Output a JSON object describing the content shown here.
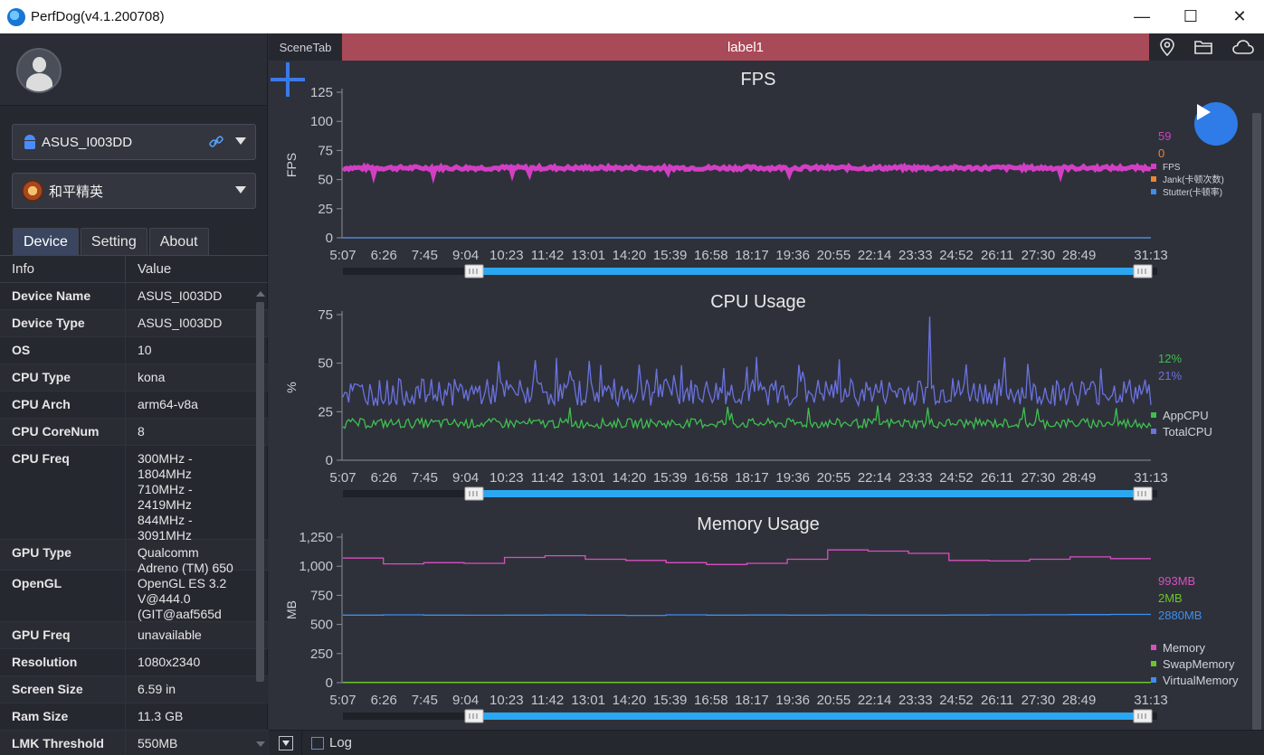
{
  "window": {
    "title": "PerfDog(v4.1.200708)",
    "controls": [
      "—",
      "☐",
      "✕"
    ]
  },
  "sidebar": {
    "device_select": "ASUS_I003DD",
    "app_select": "和平精英",
    "tabs": [
      {
        "label": "Device",
        "active": true
      },
      {
        "label": "Setting",
        "active": false
      },
      {
        "label": "About",
        "active": false
      }
    ],
    "info_header": {
      "key": "Info",
      "value": "Value"
    },
    "info_rows": [
      {
        "key": "Device Name",
        "value": "ASUS_I003DD"
      },
      {
        "key": "Device Type",
        "value": "ASUS_I003DD"
      },
      {
        "key": "OS",
        "value": "10"
      },
      {
        "key": "CPU Type",
        "value": "kona"
      },
      {
        "key": "CPU Arch",
        "value": "arm64-v8a"
      },
      {
        "key": "CPU CoreNum",
        "value": "8"
      },
      {
        "key": "CPU Freq",
        "value": "300MHz -\n1804MHz\n710MHz -\n2419MHz\n844MHz -\n3091MHz"
      },
      {
        "key": "GPU Type",
        "value": "Qualcomm\nAdreno (TM) 650"
      },
      {
        "key": "OpenGL",
        "value": "OpenGL ES 3.2\nV@444.0\n(GIT@aaf565d"
      },
      {
        "key": "GPU Freq",
        "value": "unavailable"
      },
      {
        "key": "Resolution",
        "value": "1080x2340"
      },
      {
        "key": "Screen Size",
        "value": "6.59 in"
      },
      {
        "key": "Ram Size",
        "value": "11.3 GB"
      },
      {
        "key": "LMK Threshold",
        "value": "550MB"
      }
    ]
  },
  "main": {
    "scene_tab": "SceneTab",
    "label": "label1",
    "top_icons": [
      "location-icon",
      "folder-icon",
      "cloud-icon"
    ],
    "log_label": "Log"
  },
  "colors": {
    "fps": "#d23fc4",
    "jank": "#f0832f",
    "stutter": "#3d8ef0",
    "appcpu": "#3fbf4f",
    "totalcpu": "#6b72e0",
    "memory": "#d94fc0",
    "swap": "#6cc627",
    "virtual": "#3d8ef0",
    "slider": "#2aa7f0",
    "axis": "#8a8e98"
  },
  "chart_data": [
    {
      "type": "line",
      "title": "FPS",
      "ylabel": "FPS",
      "ylim": [
        0,
        125
      ],
      "yticks": [
        "0",
        "25",
        "50",
        "75",
        "100",
        "125"
      ],
      "x_ticks": [
        "5:07",
        "6:26",
        "7:45",
        "9:04",
        "10:23",
        "11:42",
        "13:01",
        "14:20",
        "15:39",
        "16:58",
        "18:17",
        "19:36",
        "20:55",
        "22:14",
        "23:33",
        "24:52",
        "26:11",
        "27:30",
        "28:49",
        "31:13"
      ],
      "current_values": [
        "59",
        "0"
      ],
      "series": [
        {
          "name": "FPS",
          "baseline": 60
        },
        {
          "name": "Jank(卡顿次数)",
          "baseline": 0
        },
        {
          "name": "Stutter(卡顿率)",
          "baseline": 0
        }
      ]
    },
    {
      "type": "line",
      "title": "CPU Usage",
      "ylabel": "%",
      "ylim": [
        0,
        75
      ],
      "yticks": [
        "0",
        "25",
        "50",
        "75"
      ],
      "x_ticks": [
        "5:07",
        "6:26",
        "7:45",
        "9:04",
        "10:23",
        "11:42",
        "13:01",
        "14:20",
        "15:39",
        "16:58",
        "18:17",
        "19:36",
        "20:55",
        "22:14",
        "23:33",
        "24:52",
        "26:11",
        "27:30",
        "28:49",
        "31:13"
      ],
      "current_values": [
        "12%",
        "21%"
      ],
      "series": [
        {
          "name": "AppCPU",
          "baseline": 19
        },
        {
          "name": "TotalCPU",
          "baseline": 35
        }
      ]
    },
    {
      "type": "line",
      "title": "Memory Usage",
      "ylabel": "MB",
      "ylim": [
        0,
        1250
      ],
      "yticks": [
        "0",
        "250",
        "500",
        "750",
        "1,000",
        "1,250"
      ],
      "x_ticks": [
        "5:07",
        "6:26",
        "7:45",
        "9:04",
        "10:23",
        "11:42",
        "13:01",
        "14:20",
        "15:39",
        "16:58",
        "18:17",
        "19:36",
        "20:55",
        "22:14",
        "23:33",
        "24:52",
        "26:11",
        "27:30",
        "28:49",
        "31:13"
      ],
      "current_values": [
        "993MB",
        "2MB",
        "2880MB"
      ],
      "series": [
        {
          "name": "Memory",
          "values": [
            1070,
            1020,
            1030,
            1025,
            1075,
            1090,
            1060,
            1050,
            1030,
            1015,
            1025,
            1060,
            1140,
            1130,
            1110,
            1050,
            1045,
            1060,
            1080,
            1065
          ]
        },
        {
          "name": "SwapMemory",
          "values": [
            2,
            2,
            2,
            2,
            2,
            2,
            2,
            2,
            2,
            2,
            2,
            2,
            2,
            2,
            2,
            2,
            2,
            2,
            2,
            2
          ]
        },
        {
          "name": "VirtualMemory",
          "values": [
            580,
            582,
            580,
            579,
            580,
            581,
            579,
            578,
            582,
            580,
            581,
            580,
            581,
            580,
            580,
            581,
            582,
            583,
            585,
            586
          ]
        }
      ]
    }
  ]
}
